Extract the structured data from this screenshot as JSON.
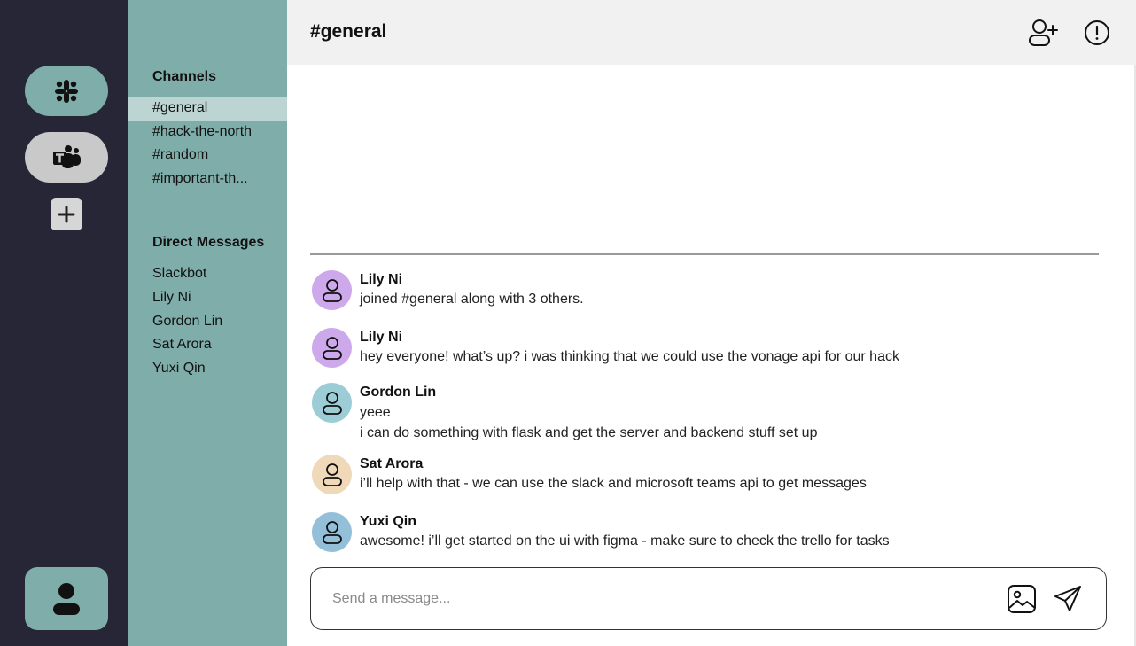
{
  "rail": {
    "workspaces": [
      {
        "name": "slack-icon"
      },
      {
        "name": "teams-icon"
      }
    ]
  },
  "sidebar": {
    "channels_title": "Channels",
    "channels": [
      "#general",
      "#hack-the-north",
      "#random",
      "#important-th..."
    ],
    "active_channel": "#general",
    "dms_title": "Direct Messages",
    "dms": [
      "Slackbot",
      "Lily Ni",
      "Gordon Lin",
      "Sat Arora",
      "Yuxi Qin"
    ]
  },
  "header": {
    "title": "#general"
  },
  "messages": [
    {
      "author": "Lily Ni",
      "lines": [
        "joined #general along with 3 others."
      ],
      "avatar_color": "#cda9ec"
    },
    {
      "author": "Lily Ni",
      "lines": [
        "hey everyone! what’s up? i was thinking that we could use the vonage api for our hack"
      ],
      "avatar_color": "#cda9ec"
    },
    {
      "author": "Gordon Lin",
      "lines": [
        "yeee",
        "i can do something with flask and get the server and backend stuff set up"
      ],
      "avatar_color": "#9ccdd6"
    },
    {
      "author": "Sat Arora",
      "lines": [
        "i’ll help with that - we can use the slack and microsoft teams api to get messages"
      ],
      "avatar_color": "#efd9b9"
    },
    {
      "author": "Yuxi Qin",
      "lines": [
        "awesome! i’ll get started on the ui with figma - make sure to check the trello for tasks"
      ],
      "avatar_color": "#93bfd9"
    }
  ],
  "composer": {
    "placeholder": "Send a message..."
  },
  "colors": {
    "rail_bg": "#262637",
    "sidebar_bg": "#7fadaa",
    "active_channel_bg": "#bcd4d2",
    "header_bg": "#f1f1f1"
  }
}
